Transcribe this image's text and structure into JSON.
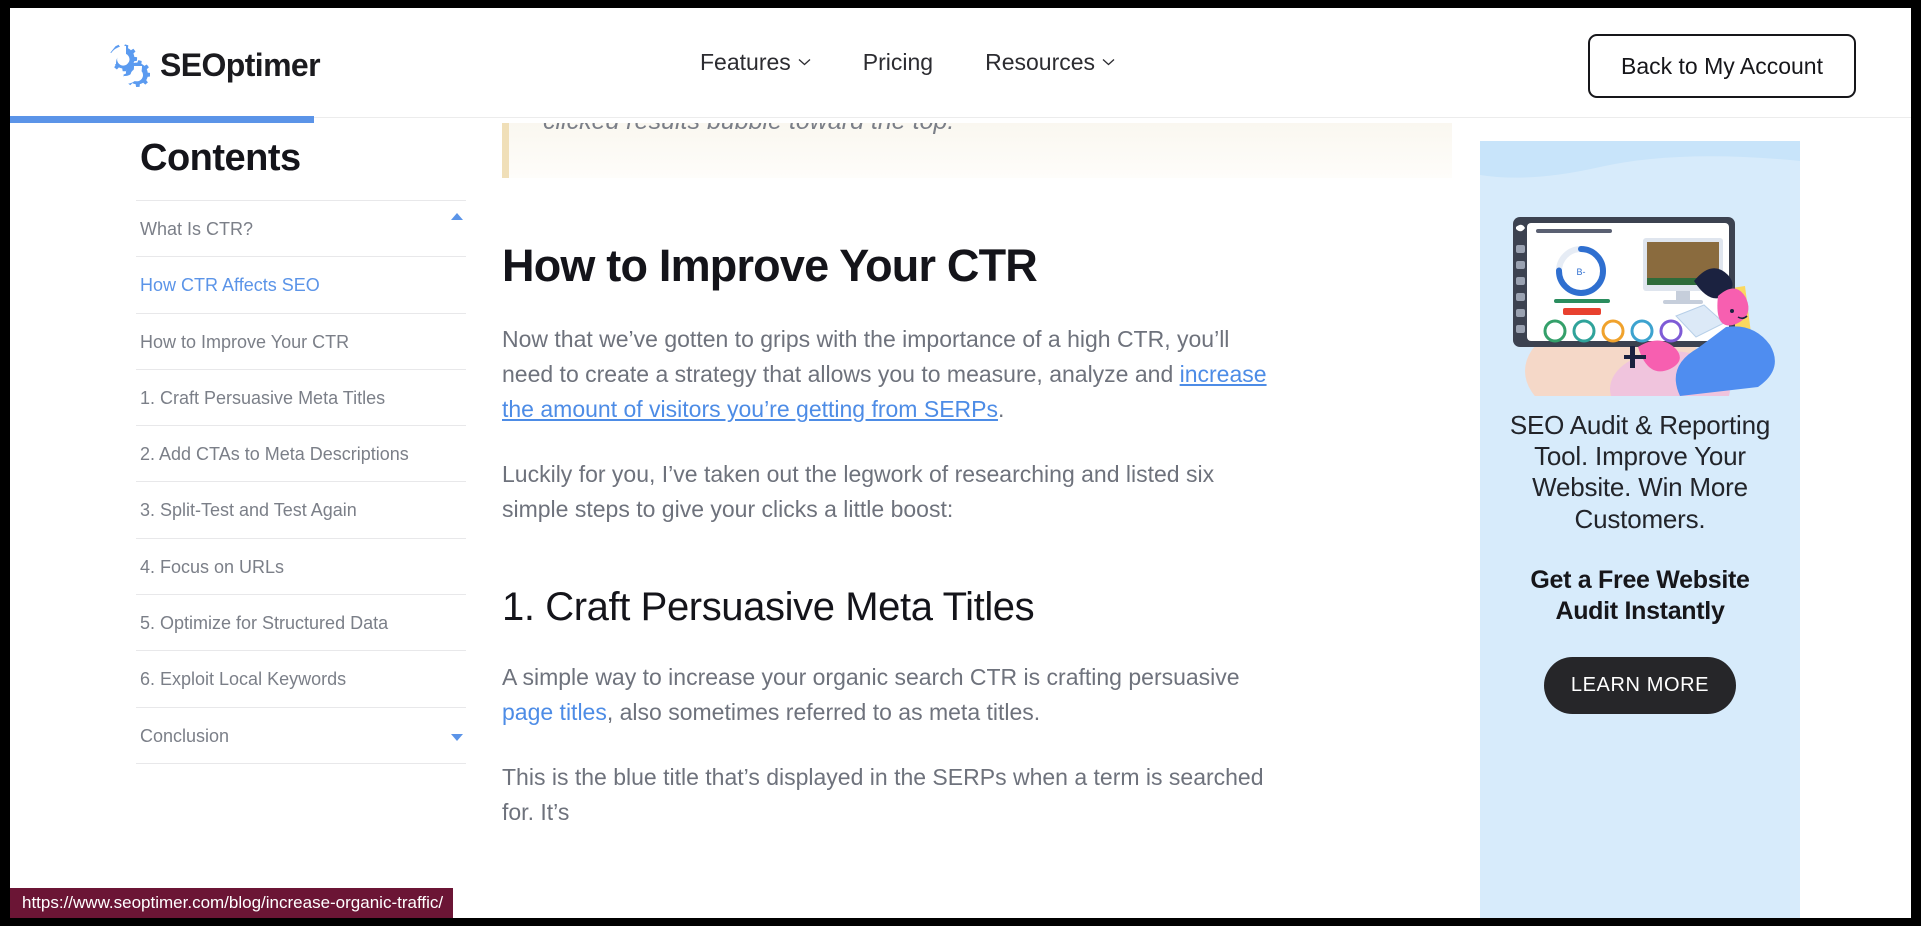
{
  "header": {
    "logo_text": "SEOptimer",
    "logo_icon": "seoptimer-gear-logo",
    "nav": [
      {
        "label": "Features",
        "has_dropdown": true
      },
      {
        "label": "Pricing",
        "has_dropdown": false
      },
      {
        "label": "Resources",
        "has_dropdown": true
      }
    ],
    "account_button_label": "Back to My Account"
  },
  "progress": {
    "percent": 16,
    "color": "#5b94e8"
  },
  "contents": {
    "title": "Contents",
    "scroll_up_icon": "caret-up-icon",
    "scroll_down_icon": "caret-down-icon",
    "items": [
      {
        "label": "What Is CTR?",
        "active": false
      },
      {
        "label": "How CTR Affects SEO",
        "active": true
      },
      {
        "label": "How to Improve Your CTR",
        "active": false
      },
      {
        "label": "1. Craft Persuasive Meta Titles",
        "active": false
      },
      {
        "label": "2. Add CTAs to Meta Descriptions",
        "active": false
      },
      {
        "label": "3. Split-Test and Test Again",
        "active": false
      },
      {
        "label": "4. Focus on URLs",
        "active": false
      },
      {
        "label": "5. Optimize for Structured Data",
        "active": false
      },
      {
        "label": "6. Exploit Local Keywords",
        "active": false
      },
      {
        "label": "Conclusion",
        "active": false
      }
    ]
  },
  "article": {
    "pullquote": "clicked results bubble toward the top.",
    "heading_h2": "How to Improve Your CTR",
    "paragraph_1": {
      "before_link": "Now that we’ve gotten to grips with the importance of a high CTR, you’ll need to create a strategy that allows you to measure, analyze and ",
      "link_text": "increase the amount of visitors you’re getting from SERPs",
      "after_link": "."
    },
    "paragraph_2": "Luckily for you, I’ve taken out the legwork of researching and listed six simple steps to give your clicks a little boost:",
    "heading_h3": "1. Craft Persuasive Meta Titles",
    "paragraph_3": {
      "before_link": "A simple way to increase your organic search CTR is crafting persuasive ",
      "link_text": "page titles",
      "after_link": ", also sometimes referred to as meta titles."
    },
    "paragraph_4": "This is the blue title that’s displayed in the SERPs when a term is searched for. It’s"
  },
  "ad": {
    "illustration_name": "seo-audit-dashboard-illustration",
    "headline": "SEO Audit & Reporting Tool. Improve Your Website. Win More Customers.",
    "subhead": "Get a Free Website Audit Instantly",
    "cta_label": "LEARN MORE",
    "background_color": "#d7ebfb",
    "cta_color": "#262629"
  },
  "status_bar": {
    "url": "https://www.seoptimer.com/blog/increase-organic-traffic/",
    "background_color": "#6b1535"
  }
}
